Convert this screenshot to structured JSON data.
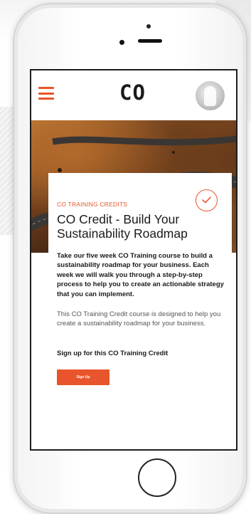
{
  "app": {
    "logo_text": "CO",
    "menu_icon": "hamburger-menu-icon",
    "avatar_icon": "user-avatar"
  },
  "card": {
    "eyebrow": "CO TRAINING CREDITS",
    "title": "CO Credit - Build Your Sustainability Roadmap",
    "intro": "Take our five week CO Training course to build a sustainability roadmap for your business. Each week we will walk you through a step-by-step process to help you to create an actionable strategy that you can implement.",
    "description": "This CO Training Credit course is designed to help you create a sustainability roadmap for your business.",
    "cta_text": "Sign up for this CO Training Credit",
    "button_label": "Sign Up",
    "status_icon": "checkmark-circle-icon"
  },
  "colors": {
    "accent": "#e8542b",
    "text": "#1a1a1a",
    "muted_text": "#555555",
    "screen_border": "#1d1d1d"
  }
}
